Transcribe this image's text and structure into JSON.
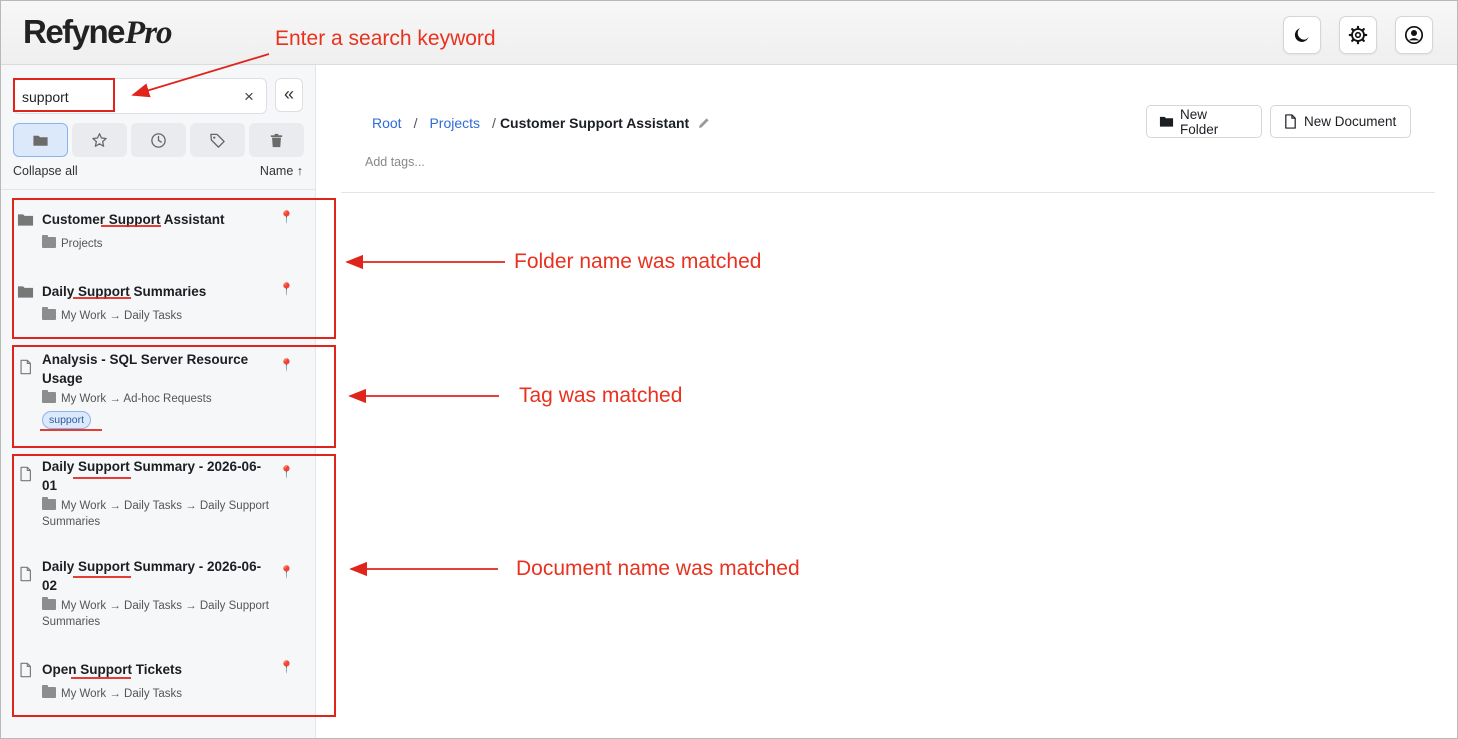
{
  "app": {
    "logo_main": "Refyne",
    "logo_pro": "Pro",
    "header_buttons": [
      {
        "icon": "moon-icon",
        "label": "Dark mode"
      },
      {
        "icon": "gear-icon",
        "label": "Settings"
      },
      {
        "icon": "user-circle-icon",
        "label": "Account"
      }
    ]
  },
  "sidebar": {
    "search": {
      "value": "support",
      "clear_glyph": "×"
    },
    "collapse_glyph": "«",
    "filters": [
      {
        "icon": "folder-icon",
        "active": true
      },
      {
        "icon": "star-icon",
        "active": false
      },
      {
        "icon": "clock-icon",
        "active": false
      },
      {
        "icon": "tag-icon",
        "active": false
      },
      {
        "icon": "trash-icon",
        "active": false
      }
    ],
    "collapse_all_label": "Collapse all",
    "sort_label": "Name ↑",
    "items": [
      {
        "type": "folder",
        "title": "Customer Support Assistant",
        "path": "Projects",
        "pinned": true
      },
      {
        "type": "folder",
        "title": "Daily Support Summaries",
        "path": "My Work → Daily Tasks",
        "pinned": true
      },
      {
        "type": "document",
        "title": "Analysis - SQL Server Resource Usage",
        "path": "My Work → Ad-hoc Requests",
        "tag": "support",
        "pinned": true
      },
      {
        "type": "document",
        "title": "Daily Support Summary - 2026-06-01",
        "path": "My Work → Daily Tasks → Daily Support Summaries",
        "pinned": true
      },
      {
        "type": "document",
        "title": "Daily Support Summary - 2026-06-02",
        "path": "My Work → Daily Tasks → Daily Support Summaries",
        "pinned": true
      },
      {
        "type": "document",
        "title": "Open Support Tickets",
        "path": "My Work → Daily Tasks",
        "pinned": true
      }
    ]
  },
  "main": {
    "breadcrumb": {
      "root": "Root",
      "sep": "/",
      "projects": "Projects",
      "current_prefix": "/",
      "current": "Customer Support Assistant"
    },
    "add_tags_placeholder": "Add tags...",
    "new_folder_label": "New Folder",
    "new_document_label": "New Document"
  },
  "annotations": {
    "search_hint": "Enter a search keyword",
    "folder_match": "Folder name was matched",
    "tag_match": "Tag was matched",
    "document_match": "Document name was matched"
  },
  "colors": {
    "annotation": "#e0241b",
    "link": "#2f6bd6",
    "active_filter": "#dce9fb"
  }
}
